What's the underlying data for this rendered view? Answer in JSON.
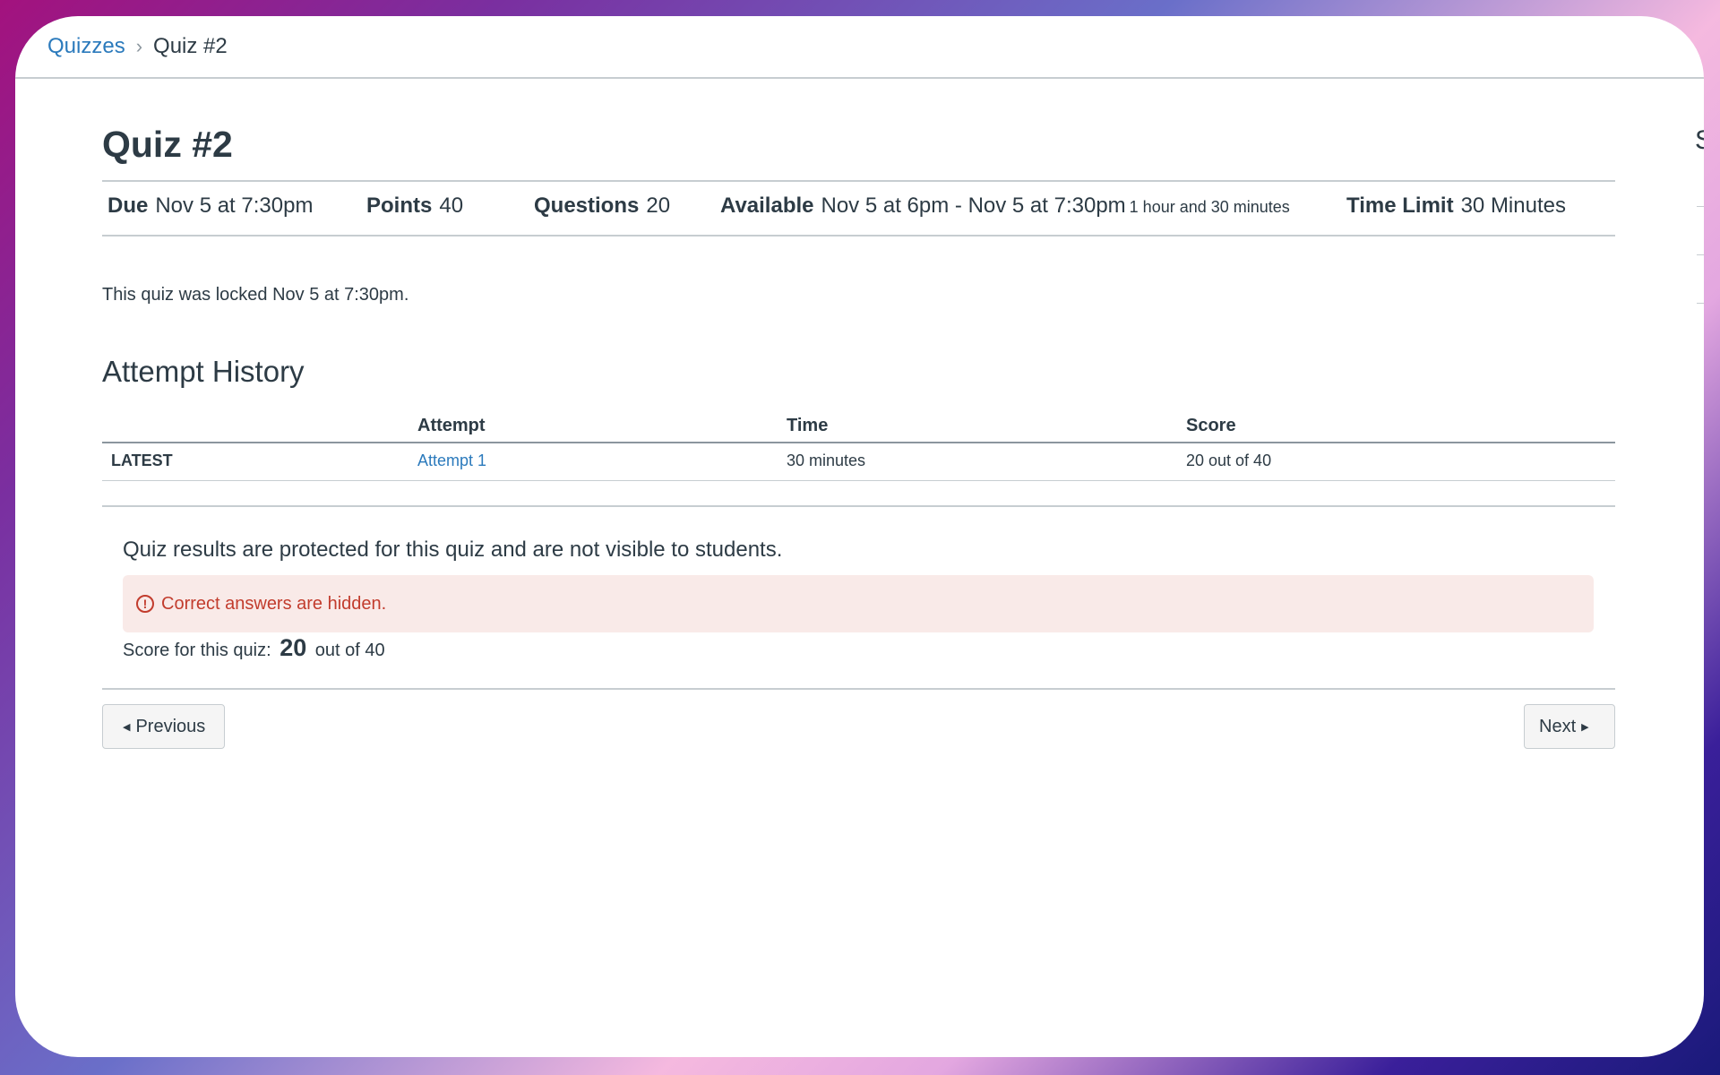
{
  "breadcrumb": {
    "parent": "Quizzes",
    "separator": "›",
    "current": "Quiz #2"
  },
  "quiz": {
    "title": "Quiz #2",
    "due_label": "Due",
    "due_value": "Nov 5 at 7:30pm",
    "points_label": "Points",
    "points_value": "40",
    "questions_label": "Questions",
    "questions_value": "20",
    "available_label": "Available",
    "available_value": "Nov 5 at 6pm - Nov 5 at 7:30pm",
    "available_duration": "1 hour and 30 minutes",
    "time_limit_label": "Time Limit",
    "time_limit_value": "30 Minutes",
    "locked_message": "This quiz was locked Nov 5 at 7:30pm."
  },
  "history": {
    "title": "Attempt History",
    "columns": [
      "Attempt",
      "Time",
      "Score"
    ],
    "rows": [
      {
        "tag": "LATEST",
        "attempt": "Attempt 1",
        "time": "30 minutes",
        "score": "20 out of 40"
      }
    ]
  },
  "results": {
    "protected_message": "Quiz results are protected for this quiz and are not visible to students.",
    "alert_icon": "!",
    "alert_text": "Correct answers are hidden.",
    "score_prefix": "Score for this quiz:",
    "score_value": "20",
    "score_suffix": "out of 40"
  },
  "nav": {
    "previous_label": "Previous",
    "next_label": "Next",
    "prev_arrow": "◀",
    "next_arrow": "▶"
  },
  "side": {
    "glyph": "S"
  },
  "colors": {
    "link": "#2b7abc",
    "alert_bg": "#f9eae8",
    "alert_text": "#c23c2d"
  }
}
